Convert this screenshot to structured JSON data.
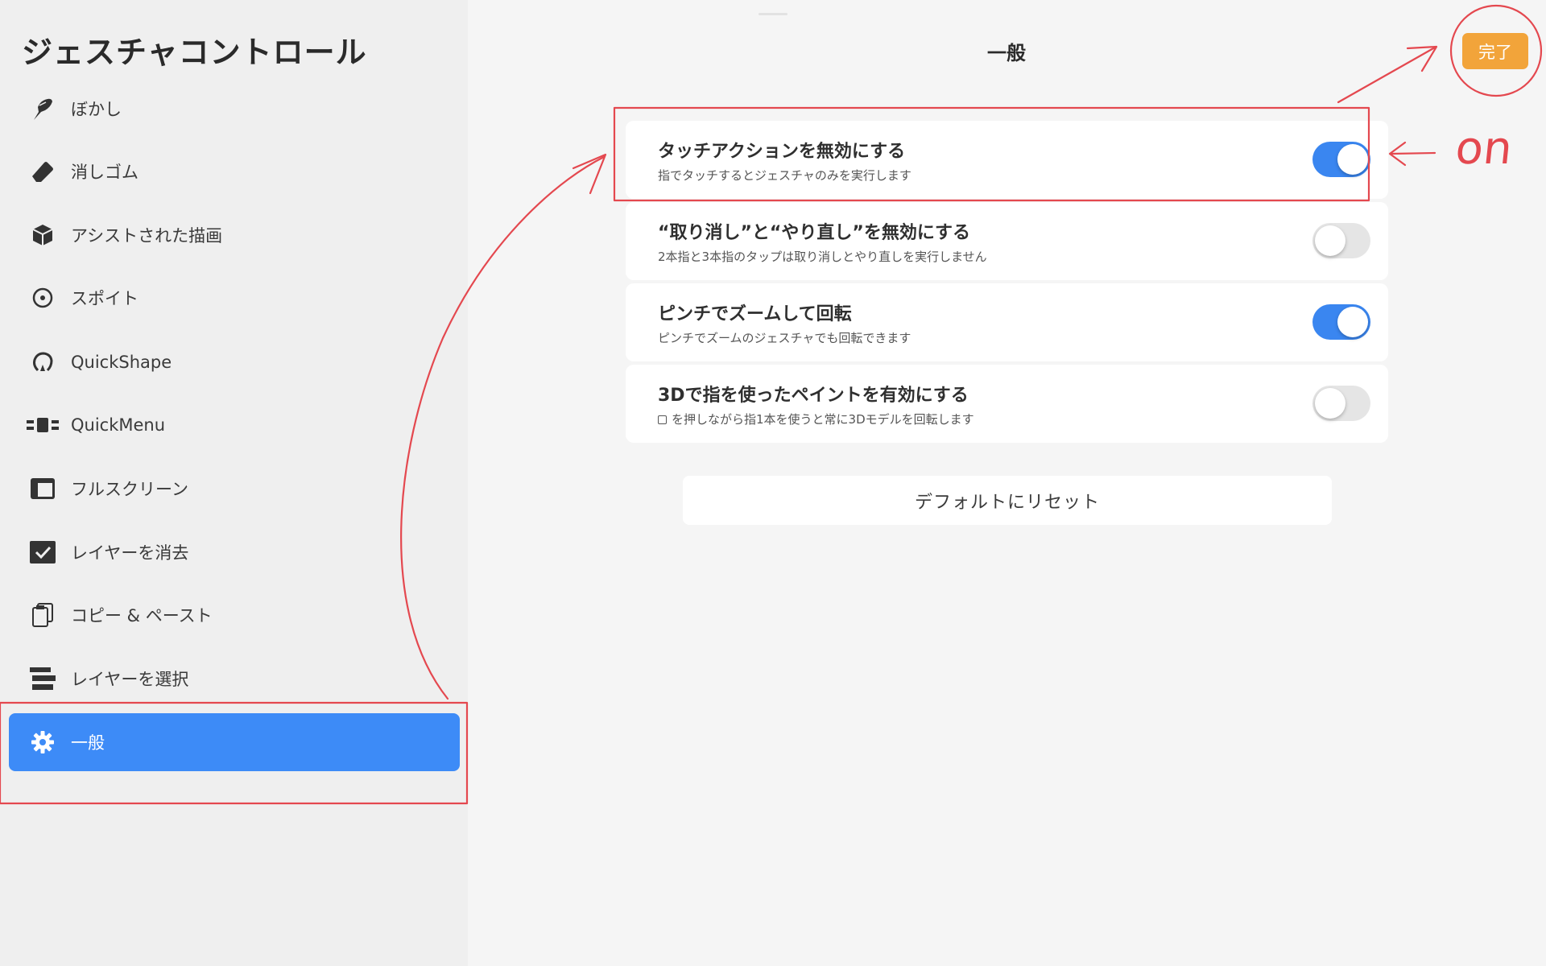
{
  "sidebar": {
    "title": "ジェスチャコントロール",
    "items": [
      {
        "label": "ぼかし",
        "icon": "smudge-icon"
      },
      {
        "label": "消しゴム",
        "icon": "eraser-icon"
      },
      {
        "label": "アシストされた描画",
        "icon": "cube-icon"
      },
      {
        "label": "スポイト",
        "icon": "eyedropper-icon"
      },
      {
        "label": "QuickShape",
        "icon": "quickshape-icon"
      },
      {
        "label": "QuickMenu",
        "icon": "quickmenu-icon"
      },
      {
        "label": "フルスクリーン",
        "icon": "fullscreen-icon"
      },
      {
        "label": "レイヤーを消去",
        "icon": "checkbox-icon"
      },
      {
        "label": "コピー & ペースト",
        "icon": "clipboard-icon"
      },
      {
        "label": "レイヤーを選択",
        "icon": "layers-icon"
      },
      {
        "label": "一般",
        "icon": "gear-icon",
        "selected": true
      }
    ]
  },
  "header": {
    "title": "一般",
    "done_label": "完了"
  },
  "settings": [
    {
      "title": "タッチアクションを無効にする",
      "desc": "指でタッチするとジェスチャのみを実行します",
      "on": true
    },
    {
      "title": "“取り消し”と“やり直し”を無効にする",
      "desc": "2本指と3本指のタップは取り消しとやり直しを実行しません",
      "on": false
    },
    {
      "title": "ピンチでズームして回転",
      "desc": "ピンチでズームのジェスチャでも回転できます",
      "on": true
    },
    {
      "title": "3Dで指を使ったペイントを有効にする",
      "desc": "を押しながら指1本を使うと常に3Dモデルを回転します",
      "on": false
    }
  ],
  "reset_label": "デフォルトにリセット",
  "annotation": {
    "text": "on"
  },
  "colors": {
    "accent": "#3d8bf7",
    "done": "#f2a43a",
    "annotation": "#e4484f"
  }
}
